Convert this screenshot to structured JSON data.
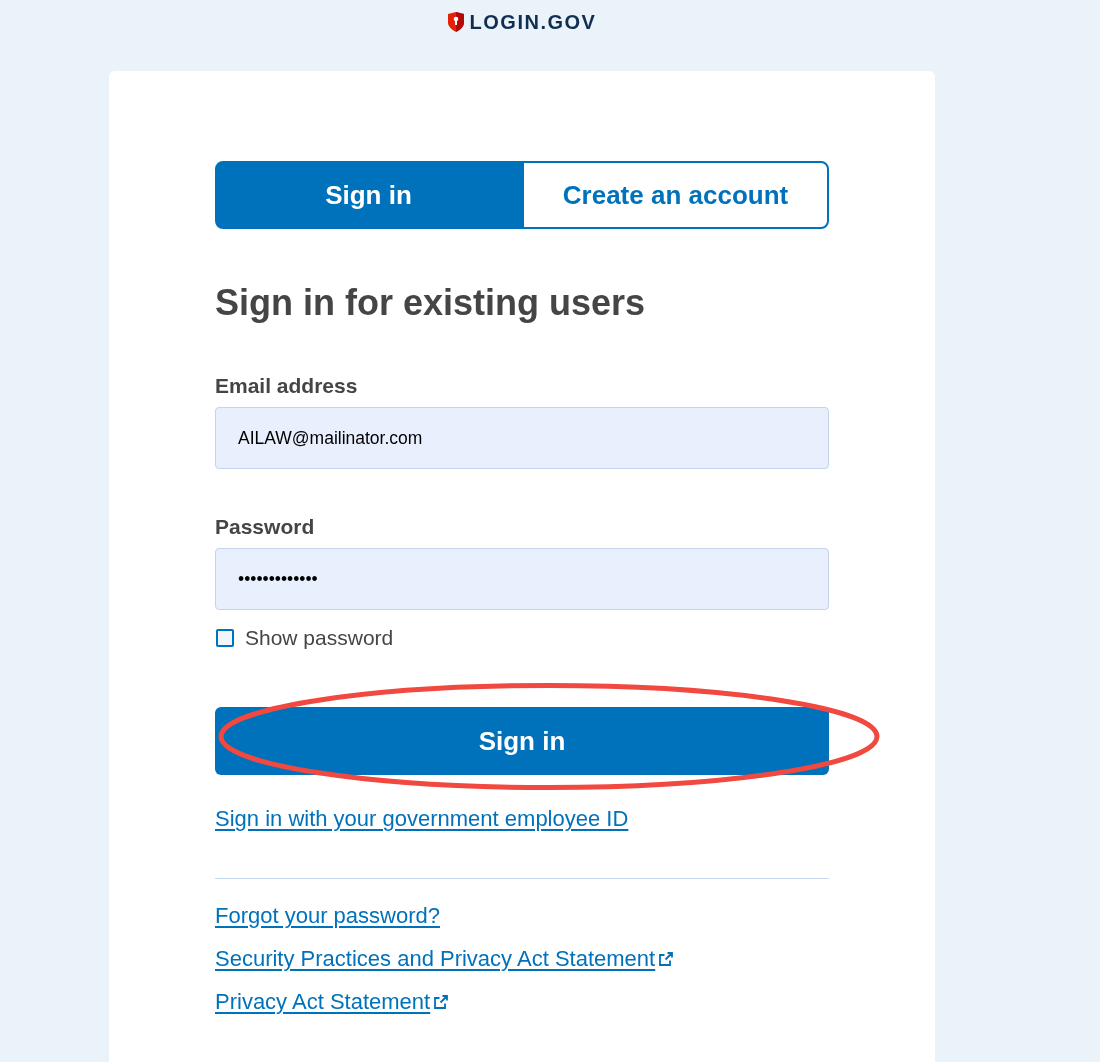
{
  "logo": {
    "text": "LOGIN.GOV"
  },
  "tabs": [
    {
      "label": "Sign in",
      "selected": true
    },
    {
      "label": "Create an account",
      "selected": false
    }
  ],
  "heading": "Sign in for existing users",
  "fields": [
    {
      "label": "Email address",
      "value": "AILAW@mailinator.com"
    },
    {
      "label": "Password",
      "value": "•••••••••••••"
    }
  ],
  "show_password": {
    "label": "Show password",
    "checked": false
  },
  "sign_in_button": {
    "label": "Sign in",
    "highlighted": true
  },
  "employee_id_link": {
    "label": "Sign in with your government employee ID"
  },
  "footer_links": [
    {
      "label": "Forgot your password?",
      "external": false
    },
    {
      "label": "Security Practices and Privacy Act Statement",
      "external": true
    },
    {
      "label": "Privacy Act Statement",
      "external": true
    }
  ]
}
